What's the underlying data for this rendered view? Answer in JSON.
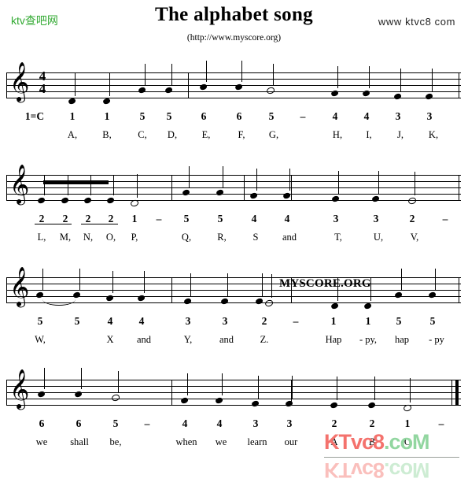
{
  "header": {
    "site_logo": "ktv查吧网",
    "title": "The alphabet song",
    "site_url_right": "www ktvc8 com",
    "source_url": "(http://www.myscore.org)"
  },
  "key_signature": "1=C",
  "time_signature": {
    "beats": "4",
    "beat_type": "4"
  },
  "clef": "treble-clef",
  "watermarks": {
    "staff_watermark": "MYSCORE.ORG",
    "bottom_red": "KTvc8",
    "bottom_green": ".coM",
    "colors": {
      "red": "#f4726d",
      "green": "#92d6a0",
      "logo_green": "#33aa33"
    }
  },
  "systems": [
    {
      "index": 1,
      "numbers": [
        "1",
        "1",
        "5",
        "5",
        "6",
        "6",
        "5",
        "–",
        "4",
        "4",
        "3",
        "3"
      ],
      "lyrics": [
        "A,",
        "B,",
        "C,",
        "D,",
        "E,",
        "F,",
        "G,",
        "",
        "H,",
        "I,",
        "J,",
        "K,"
      ]
    },
    {
      "index": 2,
      "numbers": [
        "2",
        "2",
        "2",
        "2",
        "1",
        "–",
        "5",
        "5",
        "4",
        "4",
        "3",
        "3",
        "2",
        "–"
      ],
      "lyrics": [
        "L,",
        "M,",
        "N,",
        "O,",
        "P,",
        "",
        "Q,",
        "R,",
        "S",
        "and",
        "T,",
        "U,",
        "V,",
        ""
      ]
    },
    {
      "index": 3,
      "numbers": [
        "5",
        "5",
        "4",
        "4",
        "3",
        "3",
        "2",
        "–",
        "1",
        "1",
        "5",
        "5"
      ],
      "lyrics": [
        "W,",
        "",
        "X",
        "and",
        "Y,",
        "and",
        "Z.",
        "",
        "Hap",
        "-  py,",
        "hap",
        "-  py"
      ]
    },
    {
      "index": 4,
      "numbers": [
        "6",
        "6",
        "5",
        "–",
        "4",
        "4",
        "3",
        "3",
        "2",
        "2",
        "1",
        "–"
      ],
      "lyrics": [
        "we",
        "shall",
        "be,",
        "",
        "when",
        "we",
        "learn",
        "our",
        "A",
        "B",
        "C",
        ""
      ]
    }
  ]
}
